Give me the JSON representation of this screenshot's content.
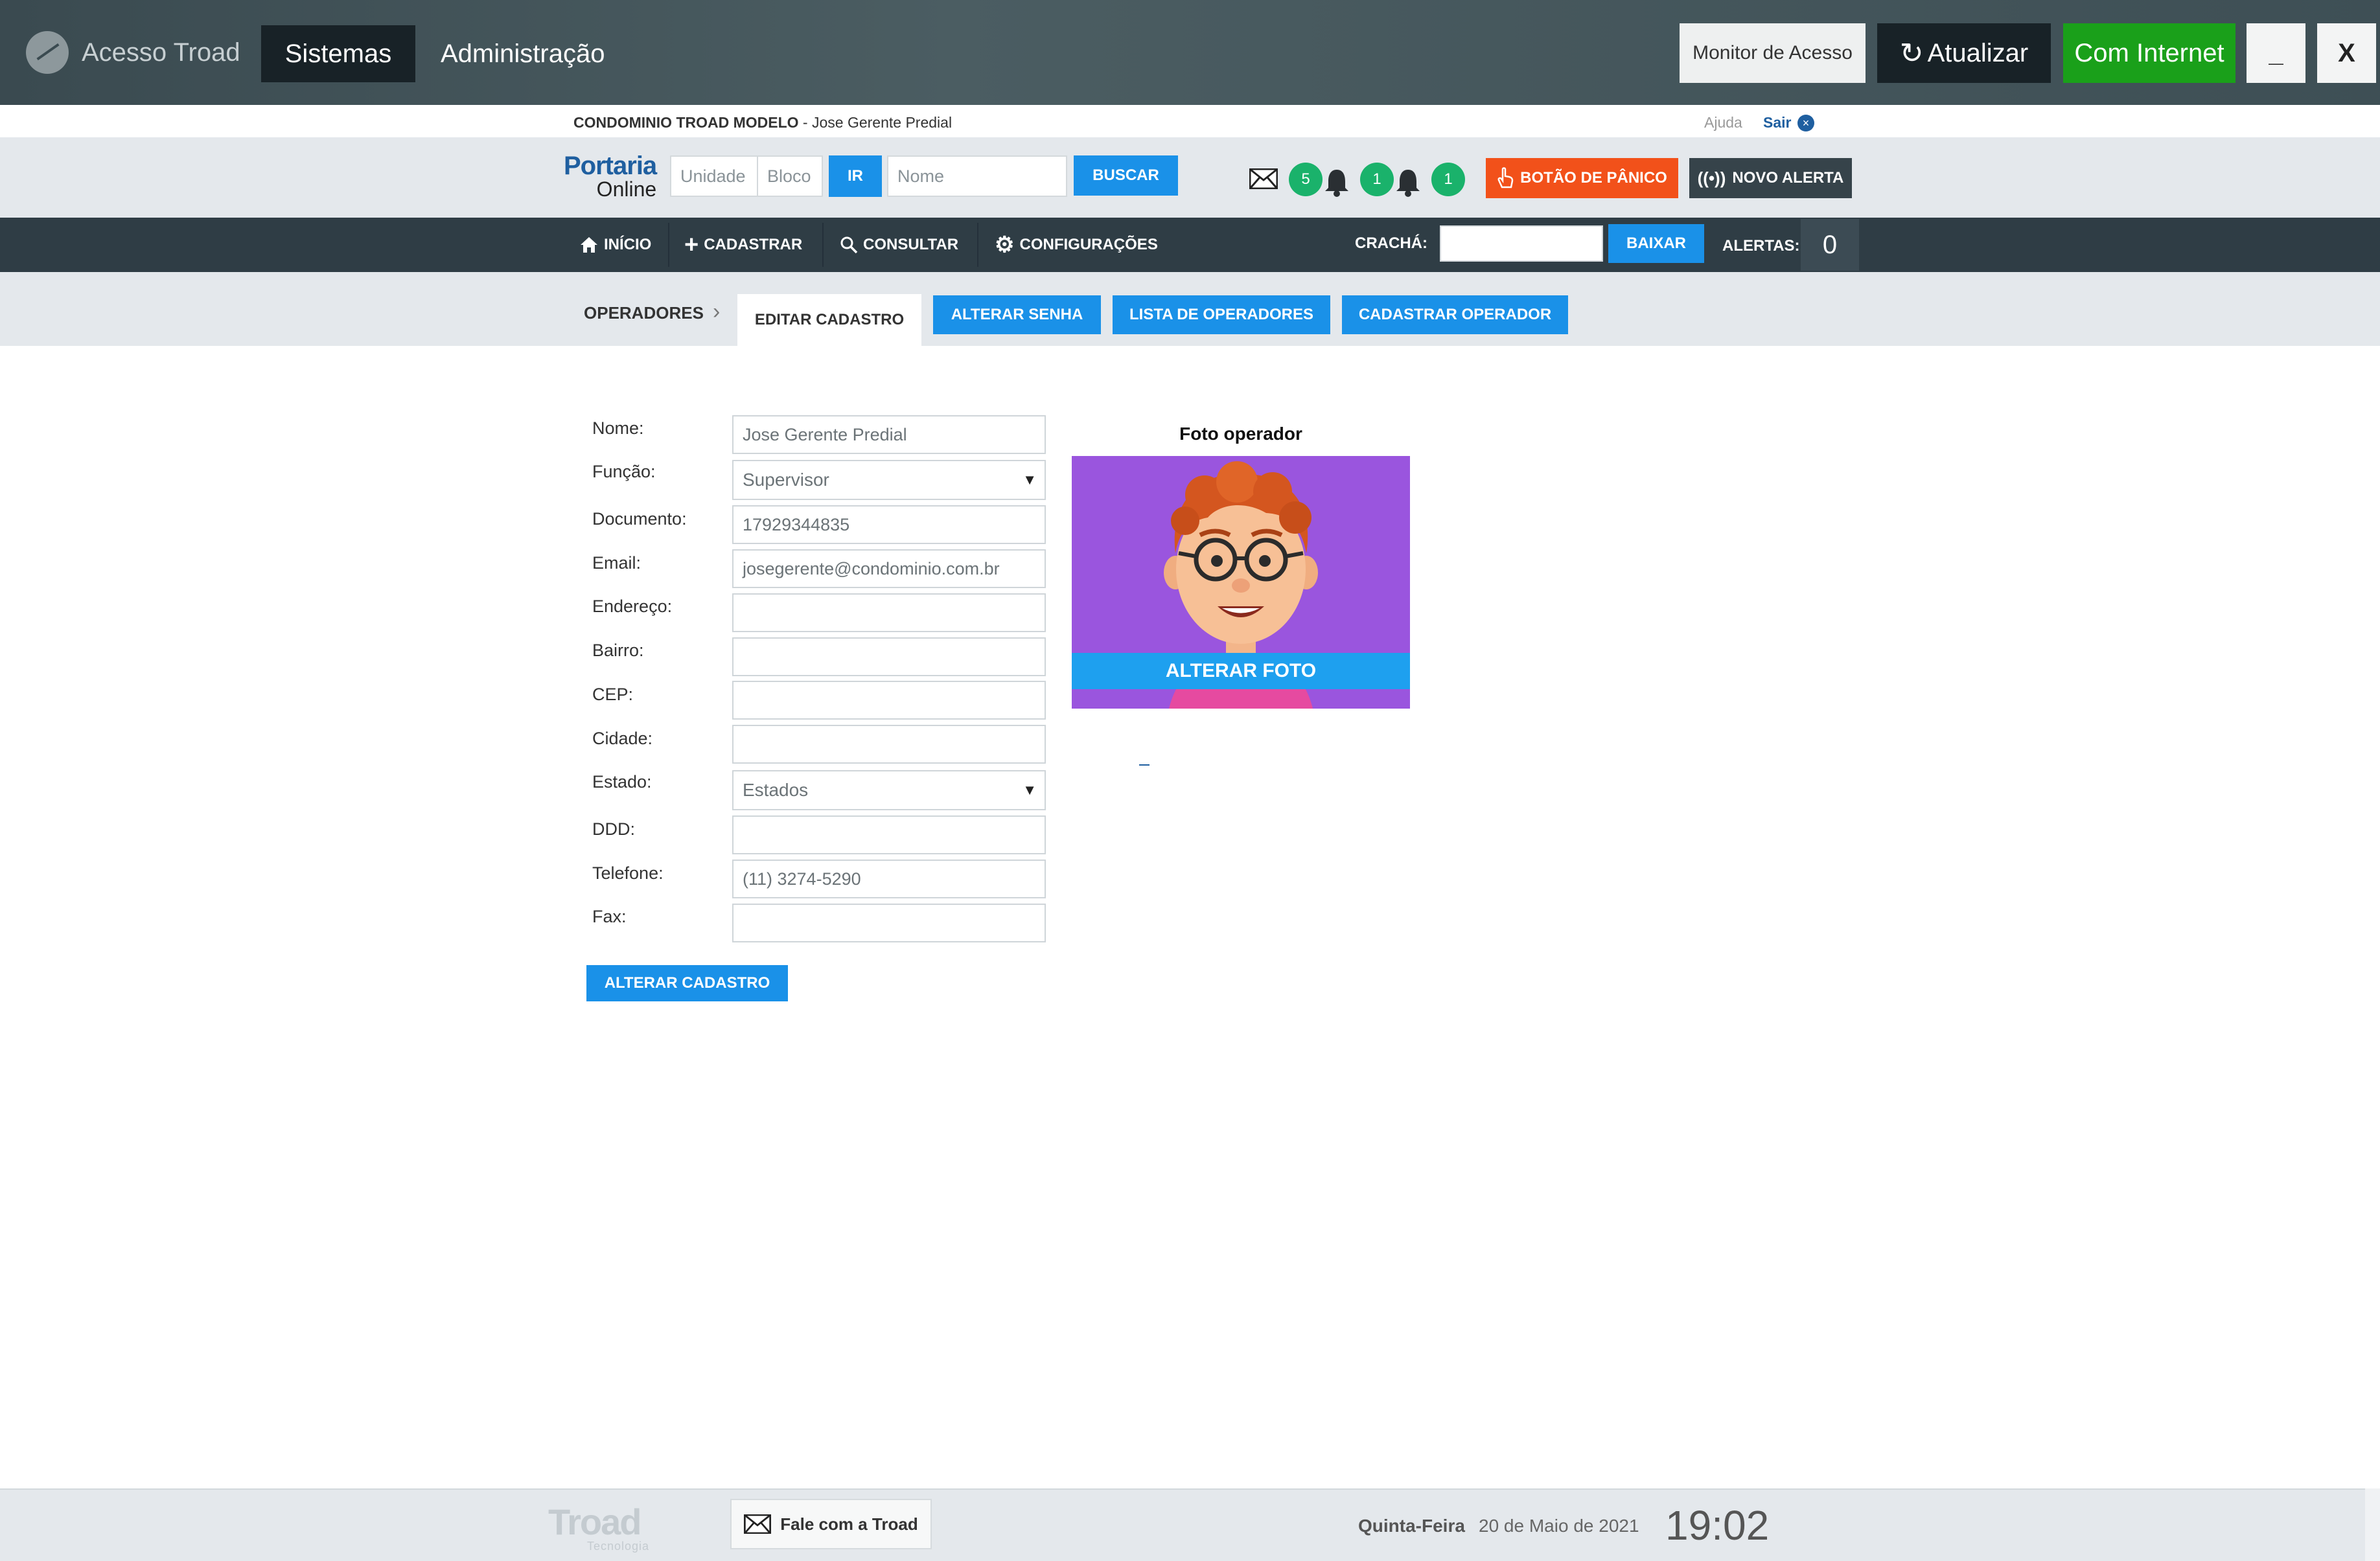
{
  "topbar": {
    "app_title": "Acesso Troad",
    "sistemas": "Sistemas",
    "administracao": "Administração",
    "monitor": "Monitor de Acesso",
    "atualizar": "Atualizar",
    "internet": "Com Internet",
    "minimize": "_",
    "close": "X",
    "colors": {
      "internet": "#1aa01a",
      "dark": "#182227"
    }
  },
  "condo": {
    "name": "CONDOMINIO TROAD MODELO",
    "user": " - Jose Gerente Predial",
    "help": "Ajuda",
    "logout": "Sair"
  },
  "search": {
    "logo_line1": "Portaria",
    "logo_line2": "Online",
    "unidade_placeholder": "Unidade",
    "bloco_placeholder": "Bloco",
    "go": "IR",
    "nome_placeholder": "Nome",
    "buscar": "BUSCAR",
    "badges": [
      "5",
      "1",
      "1"
    ],
    "panic": "BOTÃO DE PÂNICO",
    "new_alert": "NOVO ALERTA",
    "colors": {
      "panic": "#f2511a",
      "badge": "#1ab26b",
      "button": "#1a91e8"
    }
  },
  "nav": {
    "inicio": "INÍCIO",
    "cadastrar": "CADASTRAR",
    "consultar": "CONSULTAR",
    "config": "CONFIGURAÇÕES",
    "cracha": "CRACHÁ:",
    "baixar": "BAIXAR",
    "alertas": "ALERTAS:",
    "alertas_count": "0"
  },
  "subnav": {
    "section": "OPERADORES",
    "active_tab": "EDITAR CADASTRO",
    "tabs": [
      "ALTERAR SENHA",
      "LISTA DE OPERADORES",
      "CADASTRAR OPERADOR"
    ]
  },
  "form": {
    "labels": {
      "nome": "Nome:",
      "funcao": "Função:",
      "documento": "Documento:",
      "email": "Email:",
      "endereco": "Endereço:",
      "bairro": "Bairro:",
      "cep": "CEP:",
      "cidade": "Cidade:",
      "estado": "Estado:",
      "ddd": "DDD:",
      "telefone": "Telefone:",
      "fax": "Fax:"
    },
    "values": {
      "nome": "Jose Gerente Predial",
      "funcao": "Supervisor",
      "documento": "17929344835",
      "email": "josegerente@condominio.com.br",
      "endereco": "",
      "bairro": "",
      "cep": "",
      "cidade": "",
      "estado": "Estados",
      "ddd": "",
      "telefone": "(11) 3274-5290",
      "fax": ""
    },
    "submit": "ALTERAR CADASTRO"
  },
  "photo": {
    "title": "Foto operador",
    "change": "ALTERAR FOTO",
    "bg_color": "#9a55de"
  },
  "footer": {
    "logo": "Troad",
    "logo_sub": "Tecnologia",
    "contact": "Fale com a Troad",
    "weekday": "Quinta-Feira",
    "date": "20 de Maio de 2021",
    "time": "19:02"
  }
}
